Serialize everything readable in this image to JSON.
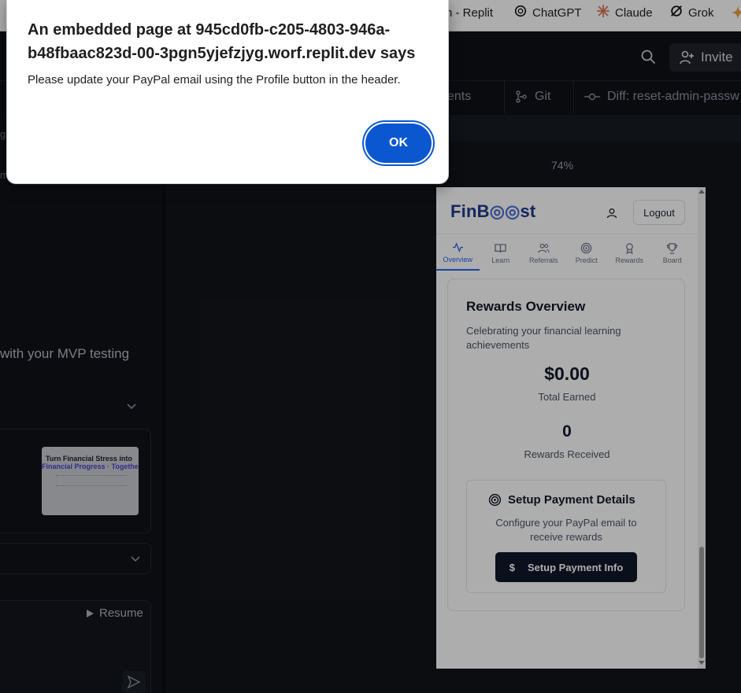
{
  "bookmarks": [
    {
      "label": "n - Replit",
      "icon": "replit-icon"
    },
    {
      "label": "ChatGPT",
      "icon": "chatgpt-icon"
    },
    {
      "label": "Claude",
      "icon": "claude-icon"
    },
    {
      "label": "Grok",
      "icon": "grok-icon"
    }
  ],
  "header": {
    "invite_label": "Invite"
  },
  "tabs": [
    {
      "label": "ents"
    },
    {
      "label": "Git"
    },
    {
      "label": "Diff: reset-admin-passw"
    }
  ],
  "left_panel": {
    "left_clip_1": "ga",
    "left_clip_2": "m",
    "message": "with your MVP testing",
    "thumb_title": "Turn Financial Stress into",
    "thumb_subtitle": "Financial Progress · Together",
    "resume_label": "Resume"
  },
  "preview": {
    "zoom": "74%",
    "logo_text_1": "FinB",
    "logo_text_2": "st",
    "logout_label": "Logout",
    "nav": [
      {
        "label": "Overview",
        "icon": "activity-icon",
        "active": true
      },
      {
        "label": "Learn",
        "icon": "book-icon",
        "active": false
      },
      {
        "label": "Referrals",
        "icon": "users-icon",
        "active": false
      },
      {
        "label": "Predict",
        "icon": "target-icon",
        "active": false
      },
      {
        "label": "Rewards",
        "icon": "award-icon",
        "active": false
      },
      {
        "label": "Board",
        "icon": "trophy-icon",
        "active": false
      }
    ],
    "rewards_title": "Rewards Overview",
    "rewards_subtitle": "Celebrating your financial learning achievements",
    "total_earned_value": "$0.00",
    "total_earned_label": "Total Earned",
    "rewards_received_value": "0",
    "rewards_received_label": "Rewards Received",
    "setup_title": "Setup Payment Details",
    "setup_desc": "Configure your PayPal email to receive rewards",
    "setup_button": "Setup Payment Info"
  },
  "dialog": {
    "title": "An embedded page at 945cd0fb-c205-4803-946a-b48fbaac823d-00-3pgn5yjefzjyg.worf.replit.dev says",
    "message": "Please update your PayPal email using the Profile button in the header.",
    "ok_label": "OK"
  },
  "colors": {
    "ok_button": "#0b57d0",
    "app_accent": "#2563eb",
    "setup_button": "#0f172a",
    "ide_bg": "#0e1117"
  }
}
